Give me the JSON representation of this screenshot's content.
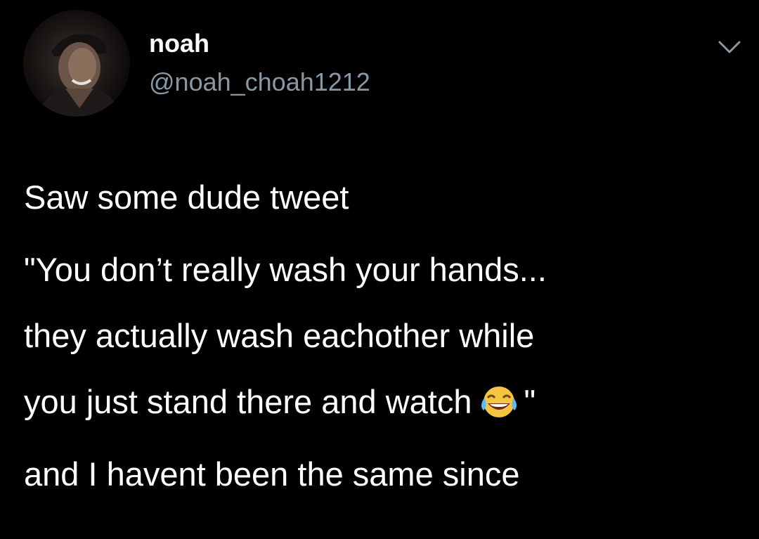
{
  "header": {
    "display_name": "noah",
    "handle": "@noah_choah1212",
    "menu_icon": "chevron-down-icon"
  },
  "avatar": {
    "icon": "profile-photo"
  },
  "tweet": {
    "line1": "Saw some dude tweet",
    "line2": "\"You don’t really wash your hands...",
    "line3": "they actually wash eachother while",
    "line4_text": "you just stand there and watch",
    "line4_emoji": "face-with-tears-of-joy",
    "line4_end": "\"",
    "line5": "and I havent been the same since"
  },
  "colors": {
    "background": "#000000",
    "text": "#ffffff",
    "handle": "#8899a6"
  }
}
